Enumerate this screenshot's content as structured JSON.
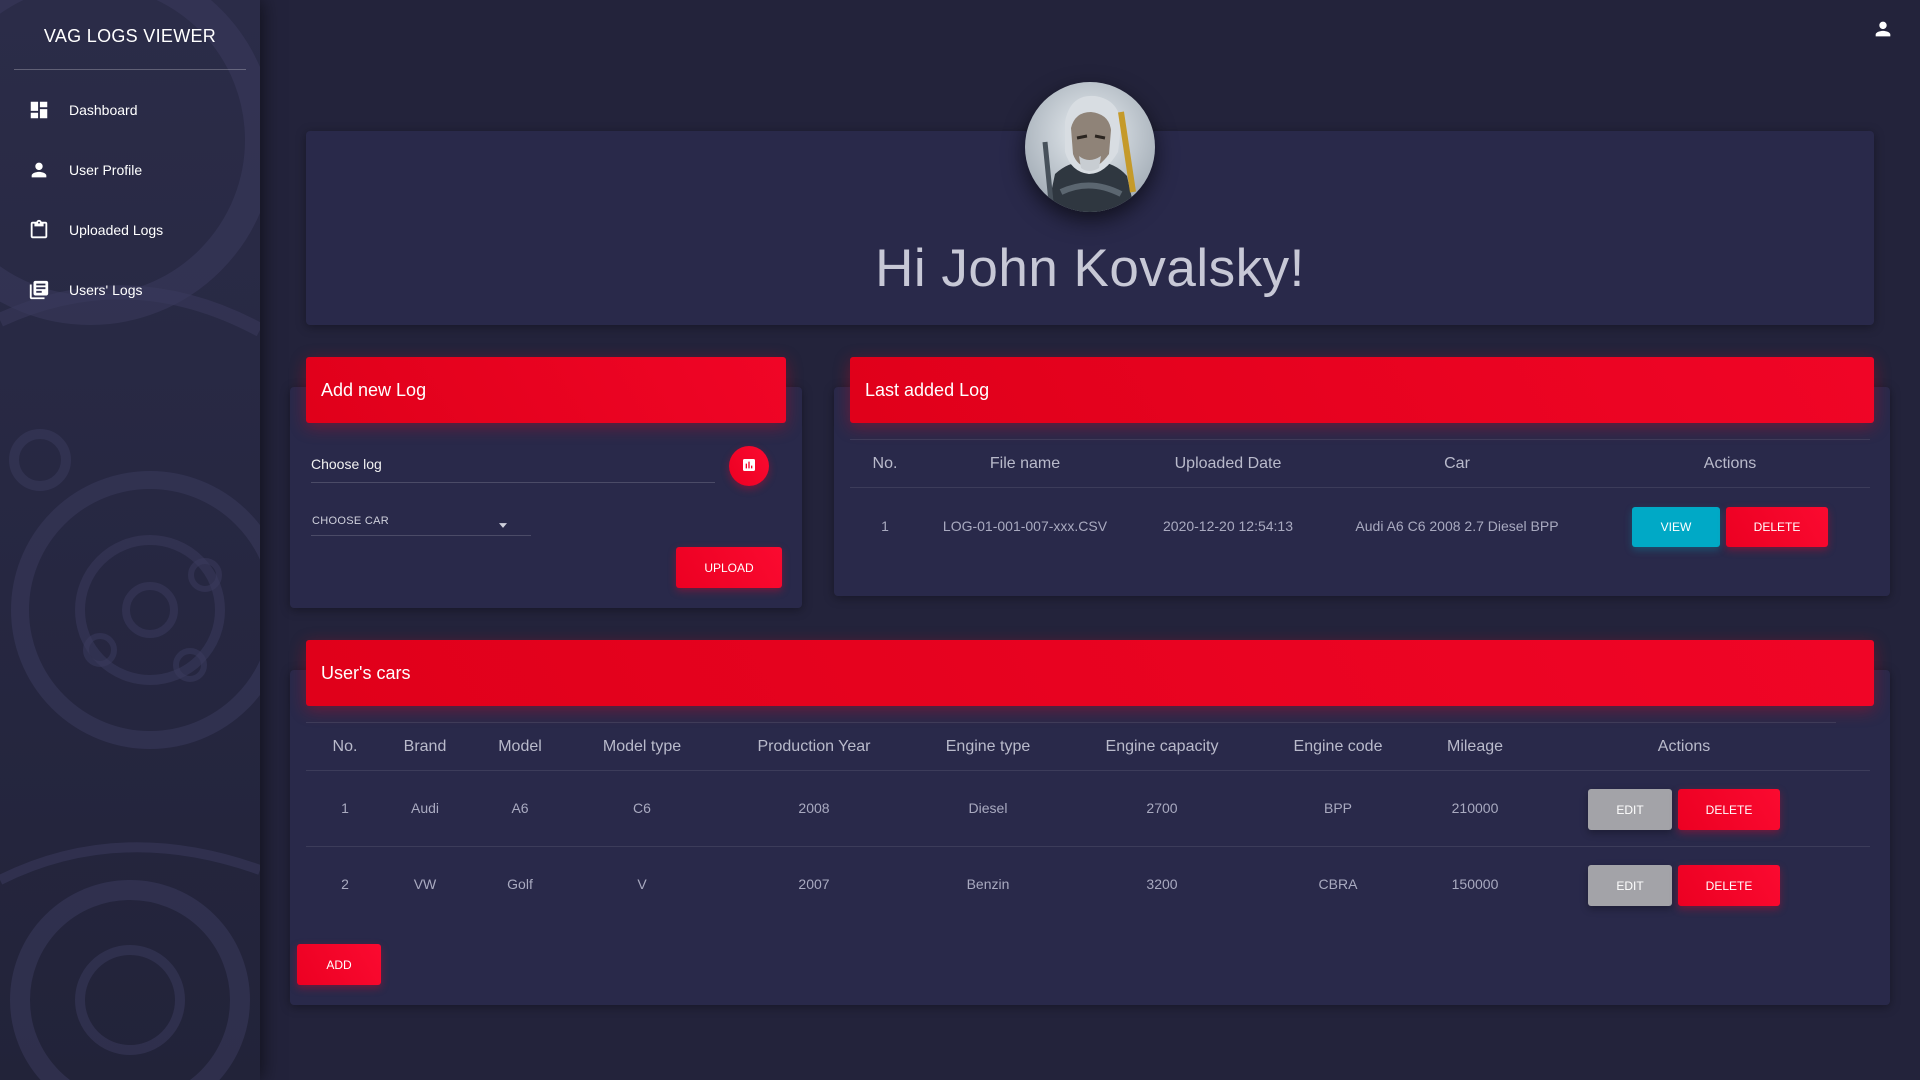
{
  "app": {
    "title": "VAG LOGS VIEWER"
  },
  "sidebar": {
    "items": [
      {
        "label": "Dashboard",
        "icon": "dashboard-icon"
      },
      {
        "label": "User Profile",
        "icon": "person-icon"
      },
      {
        "label": "Uploaded Logs",
        "icon": "clipboard-icon"
      },
      {
        "label": "Users' Logs",
        "icon": "library-books-icon"
      }
    ]
  },
  "header": {
    "user_icon": "person-icon"
  },
  "profile": {
    "greeting": "Hi John Kovalsky!"
  },
  "add_log": {
    "title": "Add new Log",
    "choose_log_label": "Choose log",
    "file_icon": "chart-file-icon",
    "choose_car_label": "CHOOSE CAR",
    "upload_label": "UPLOAD"
  },
  "last_log": {
    "title": "Last added Log",
    "columns": [
      "No.",
      "File name",
      "Uploaded Date",
      "Car",
      "Actions"
    ],
    "rows": [
      {
        "no": "1",
        "file_name": "LOG-01-001-007-xxx.CSV",
        "uploaded_date": "2020-12-20 12:54:13",
        "car": "Audi A6 C6 2008 2.7 Diesel BPP",
        "view_label": "VIEW",
        "delete_label": "DELETE"
      }
    ]
  },
  "cars": {
    "title": "User's cars",
    "columns": [
      "No.",
      "Brand",
      "Model",
      "Model type",
      "Production Year",
      "Engine type",
      "Engine capacity",
      "Engine code",
      "Mileage",
      "Actions"
    ],
    "rows": [
      {
        "no": "1",
        "brand": "Audi",
        "model": "A6",
        "model_type": "C6",
        "year": "2008",
        "engine_type": "Diesel",
        "capacity": "2700",
        "code": "BPP",
        "mileage": "210000",
        "edit_label": "EDIT",
        "delete_label": "DELETE"
      },
      {
        "no": "2",
        "brand": "VW",
        "model": "Golf",
        "model_type": "V",
        "year": "2007",
        "engine_type": "Benzin",
        "capacity": "3200",
        "code": "CBRA",
        "mileage": "150000",
        "edit_label": "EDIT",
        "delete_label": "DELETE"
      }
    ],
    "add_label": "ADD"
  },
  "colors": {
    "accent": "#ec0022",
    "view": "#00a9c6",
    "edit": "#a3a3a8",
    "background": "#23233b",
    "card": "#29294a"
  }
}
